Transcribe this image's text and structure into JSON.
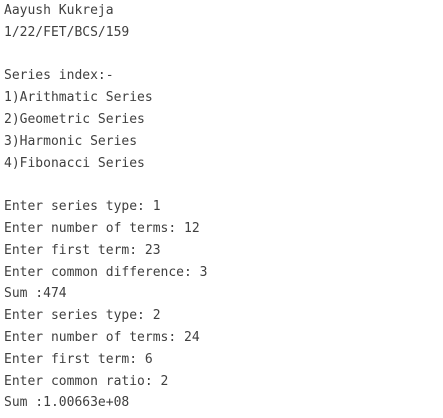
{
  "console": {
    "header": {
      "name": "Aayush Kukreja",
      "roll": "1/22/FET/BCS/159"
    },
    "menu": {
      "title": "Series index:-",
      "items": [
        "1)Arithmatic Series",
        "2)Geometric Series",
        "3)Harmonic Series",
        "4)Fibonacci Series"
      ]
    },
    "runs": [
      {
        "lines": [
          "Enter series type: 1",
          "Enter number of terms: 12",
          "Enter first term: 23",
          "Enter common difference: 3",
          "Sum :474"
        ]
      },
      {
        "lines": [
          "Enter series type: 2",
          "Enter number of terms: 24",
          "Enter first term: 6",
          "Enter common ratio: 2",
          "Sum :1.00663e+08"
        ]
      }
    ]
  }
}
